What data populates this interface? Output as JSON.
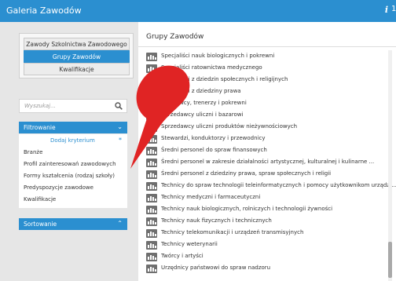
{
  "window": {
    "title": "Galeria Zawodów",
    "info_icon": "i",
    "edge_glyph": "1"
  },
  "sidebar": {
    "nav": [
      {
        "label": "Zawody Szkolnictwa Zawodowego",
        "active": false
      },
      {
        "label": "Grupy Zawodów",
        "active": true
      },
      {
        "label": "Kwalifikacje",
        "active": false
      }
    ],
    "search": {
      "placeholder": "Wyszukaj...",
      "icon": "search-icon"
    },
    "filter": {
      "title": "Filtrowanie",
      "chevron": "⌄",
      "add_label": "Dodaj kryterium",
      "add_icon": "*",
      "criteria": [
        "Branże",
        "Profil zainteresowań zawodowych",
        "Formy kształcenia (rodzaj szkoły)",
        "Predyspozycje zawodowe",
        "Kwalifikacje"
      ]
    },
    "sort": {
      "title": "Sortowanie",
      "chevron": "⌃"
    }
  },
  "main": {
    "heading": "Grupy Zawodów",
    "items": [
      "Specjaliści nauk biologicznych i pokrewni",
      "Specjaliści ratownictwa medycznego",
      "Specjaliści z dziedzin społecznych i religijnych",
      "Specjaliści z dziedziny prawa",
      "Sportowcy, trenerzy i pokrewni",
      "Sprzedawcy uliczni i bazarowi",
      "Sprzedawcy uliczni produktów nieżywnościowych",
      "Stewardzi, konduktorzy i przewodnicy",
      "Średni personel do spraw finansowych",
      "Średni personel w zakresie działalności artystycznej, kulturalnej i kulinarne ...",
      "Średni personel z dziedziny prawa, spraw społecznych i religii",
      "Technicy do spraw technologii teleinformatycznych i pomocy użytkownikom urządz ...",
      "Technicy medyczni i farmaceutyczni",
      "Technicy nauk biologicznych, rolniczych i technologii żywności",
      "Technicy nauk fizycznych i technicznych",
      "Technicy telekomunikacji i urządzeń transmisyjnych",
      "Technicy weterynarii",
      "Twórcy i artyści",
      "Urzędnicy państwowi do spraw nadzoru"
    ]
  },
  "colors": {
    "accent": "#2b8fd0",
    "callout": "#e02424",
    "icon": "#6f6f6f"
  }
}
